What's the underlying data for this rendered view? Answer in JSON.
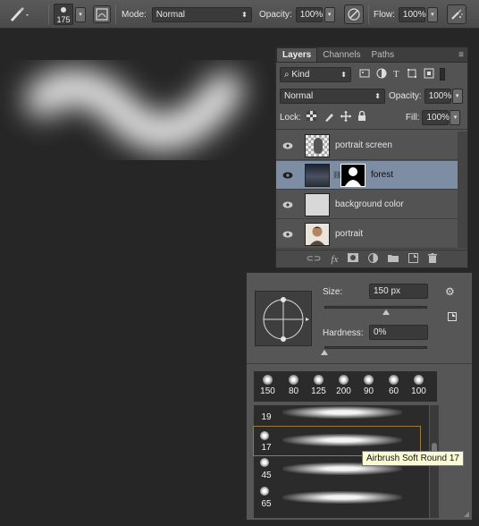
{
  "options_bar": {
    "brush_size": "175",
    "mode_label": "Mode:",
    "mode_value": "Normal",
    "opacity_label": "Opacity:",
    "opacity_value": "100%",
    "flow_label": "Flow:",
    "flow_value": "100%"
  },
  "layers_panel": {
    "tabs": [
      "Layers",
      "Channels",
      "Paths"
    ],
    "filter_value": "Kind",
    "blend_mode": "Normal",
    "opacity_label": "Opacity:",
    "opacity_value": "100%",
    "lock_label": "Lock:",
    "fill_label": "Fill:",
    "fill_value": "100%",
    "layers": [
      {
        "name": "portrait screen",
        "selected": false
      },
      {
        "name": "forest",
        "selected": true
      },
      {
        "name": "background color",
        "selected": false
      },
      {
        "name": "portrait",
        "selected": false
      }
    ],
    "footer_icons": [
      "link-icon",
      "fx-icon",
      "mask-icon",
      "adjustment-icon",
      "folder-icon",
      "new-layer-icon",
      "trash-icon"
    ]
  },
  "brush_picker": {
    "size_label": "Size:",
    "size_value": "150 px",
    "hardness_label": "Hardness:",
    "hardness_value": "0%",
    "size_fraction": 0.6,
    "hardness_fraction": 0.0,
    "presets": [
      "150",
      "80",
      "125",
      "200",
      "90",
      "60",
      "100"
    ],
    "brushes": [
      {
        "size": "19"
      },
      {
        "size": "17",
        "selected": true
      },
      {
        "size": "45"
      },
      {
        "size": "65"
      }
    ],
    "tooltip": "Airbrush Soft Round 17"
  }
}
